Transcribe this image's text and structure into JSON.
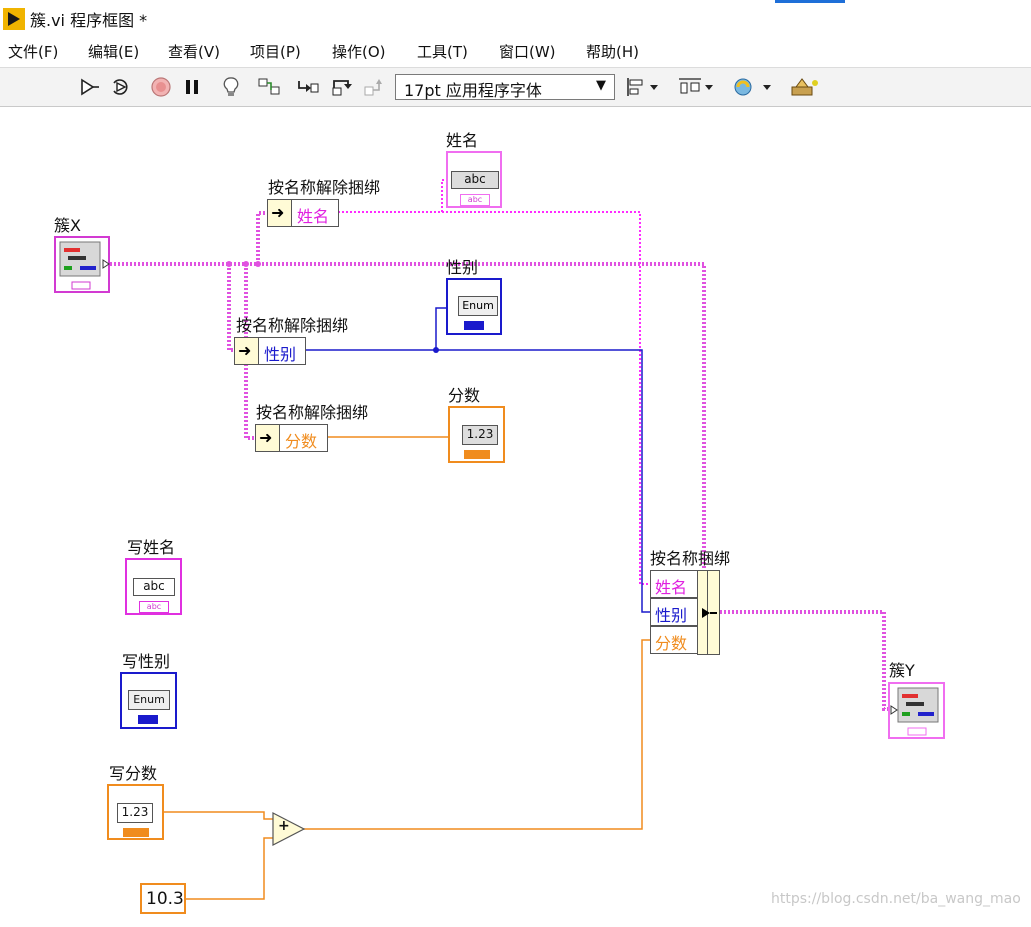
{
  "window": {
    "title": "簇.vi 程序框图 *"
  },
  "menu": {
    "items": [
      "文件(F)",
      "编辑(E)",
      "查看(V)",
      "项目(P)",
      "操作(O)",
      "工具(T)",
      "窗口(W)",
      "帮助(H)"
    ]
  },
  "toolbar": {
    "icons": [
      "run-arrow-icon",
      "run-continuously-icon",
      "abort-icon",
      "pause-icon",
      "highlight-execution-icon",
      "retain-wire-values-icon",
      "step-into-icon",
      "step-over-icon",
      "step-out-icon",
      "align-objects-icon",
      "distribute-objects-icon",
      "reorder-icon",
      "clean-up-diagram-icon"
    ],
    "font_select": "17pt 应用程序字体"
  },
  "diagram": {
    "cluster_x_label": "簇X",
    "cluster_y_label": "簇Y",
    "unbundle_by_name_label": "按名称解除捆绑",
    "bundle_by_name_label": "按名称捆绑",
    "fields": {
      "name": "姓名",
      "gender": "性别",
      "score": "分数"
    },
    "indicators": {
      "name": "姓名",
      "gender": "性别",
      "score": "分数"
    },
    "controls": {
      "write_name": "写姓名",
      "write_gender": "写性别",
      "write_score": "写分数"
    },
    "terminal_text": {
      "string": "abc",
      "enum": "Enum",
      "numeric": "1.23"
    },
    "constant_value": "10.3",
    "add_symbol": "+"
  },
  "watermark": "https://blog.csdn.net/ba_wang_mao",
  "colors": {
    "string_wire": "#ff00ff",
    "enum_wire": "#1a1acc",
    "numeric_wire": "#f08c1e",
    "cluster_wire": "#cc33cc",
    "node_fill": "#fffbd6"
  }
}
